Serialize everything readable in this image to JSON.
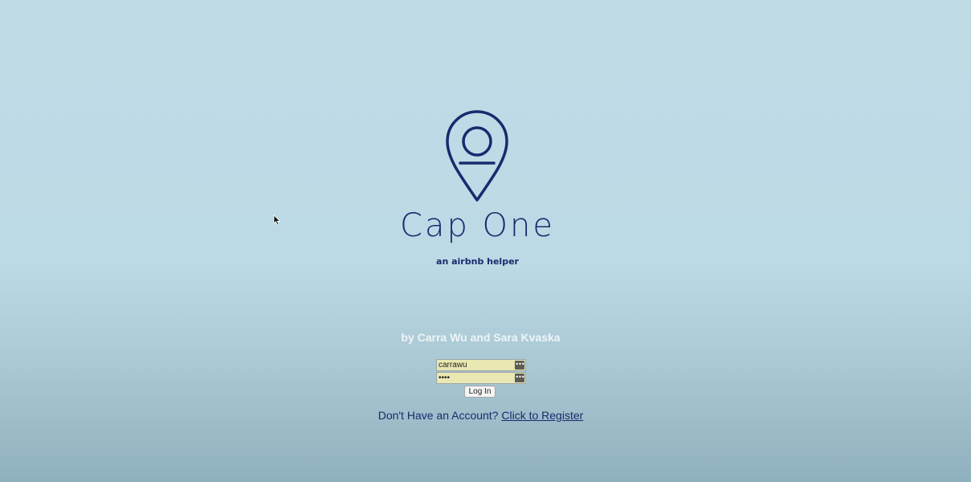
{
  "app": {
    "title": "Cap One",
    "subtitle": "an airbnb helper",
    "credits": "by Carra Wu and Sara Kvaska"
  },
  "login": {
    "username_value": "carrawu",
    "password_value": "••••",
    "login_button": "Log In",
    "key_icon": "•••"
  },
  "register": {
    "prompt": "Don't Have an Account?",
    "link": "Click to Register"
  },
  "colors": {
    "background": "#bfdbe6",
    "brand": "#1a2a6e",
    "field_bg": "#e9e8b2"
  }
}
